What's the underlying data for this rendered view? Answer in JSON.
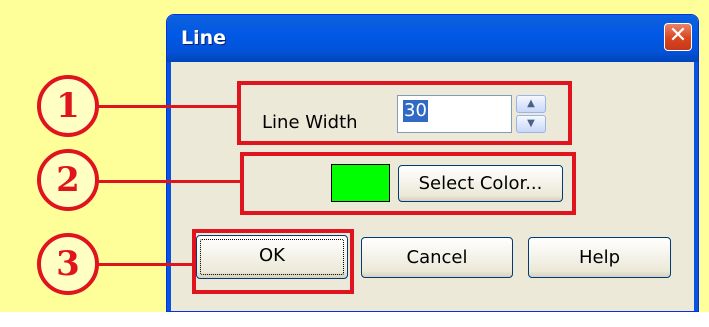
{
  "dialog": {
    "title": "Line",
    "close_glyph": "✕",
    "line_width": {
      "label": "Line Width",
      "value": "30"
    },
    "color": {
      "swatch_color": "#00ff00",
      "select_button_label": "Select Color..."
    },
    "buttons": {
      "ok": "OK",
      "cancel": "Cancel",
      "help": "Help"
    }
  },
  "annotations": [
    {
      "number": "1",
      "target": "line-width-row"
    },
    {
      "number": "2",
      "target": "color-row"
    },
    {
      "number": "3",
      "target": "ok-button"
    }
  ],
  "colors": {
    "annotation_red": "#e0141e",
    "background_yellow": "#ffff99",
    "titlebar_blue": "#0058e6"
  }
}
